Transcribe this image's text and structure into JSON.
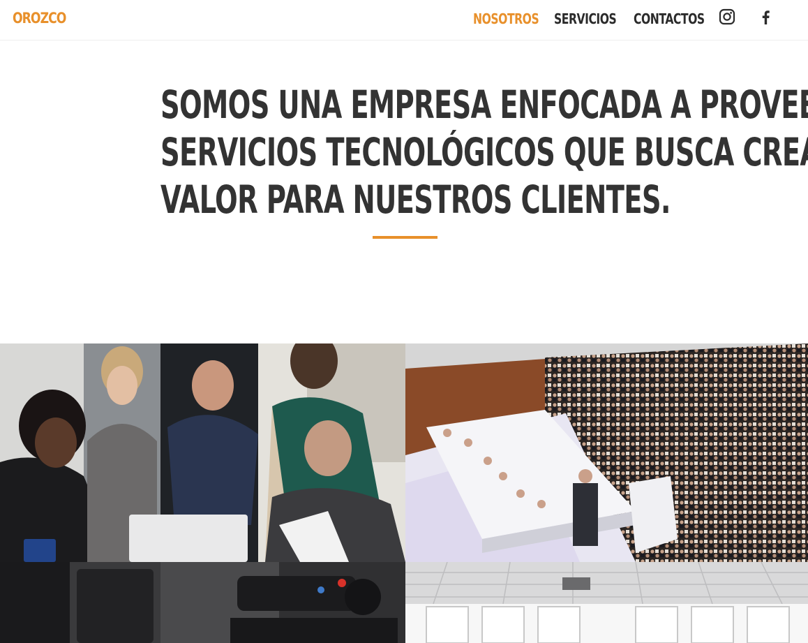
{
  "brand": {
    "name": "OROZCO",
    "color": "#e8902b"
  },
  "nav": {
    "items": [
      {
        "label": "NOSOTROS",
        "active": true
      },
      {
        "label": "SERVICIOS",
        "active": false
      },
      {
        "label": "CONTACTOS",
        "active": false
      }
    ],
    "social": [
      {
        "icon": "instagram-icon"
      },
      {
        "icon": "facebook-icon"
      }
    ]
  },
  "hero": {
    "lines": [
      "SOMOS UNA EMPRESA ENFOCADA A PROVEER",
      "SERVICIOS TECNOLÓGICOS QUE BUSCA CREAR",
      "VALOR PARA NUESTROS CLIENTES."
    ],
    "accent_color": "#e8902b"
  },
  "gallery": [
    {
      "subject": "team-meeting-laptop"
    },
    {
      "subject": "conference-auditorium"
    },
    {
      "subject": "video-camera-equipment"
    },
    {
      "subject": "empty-office-ceiling"
    }
  ]
}
